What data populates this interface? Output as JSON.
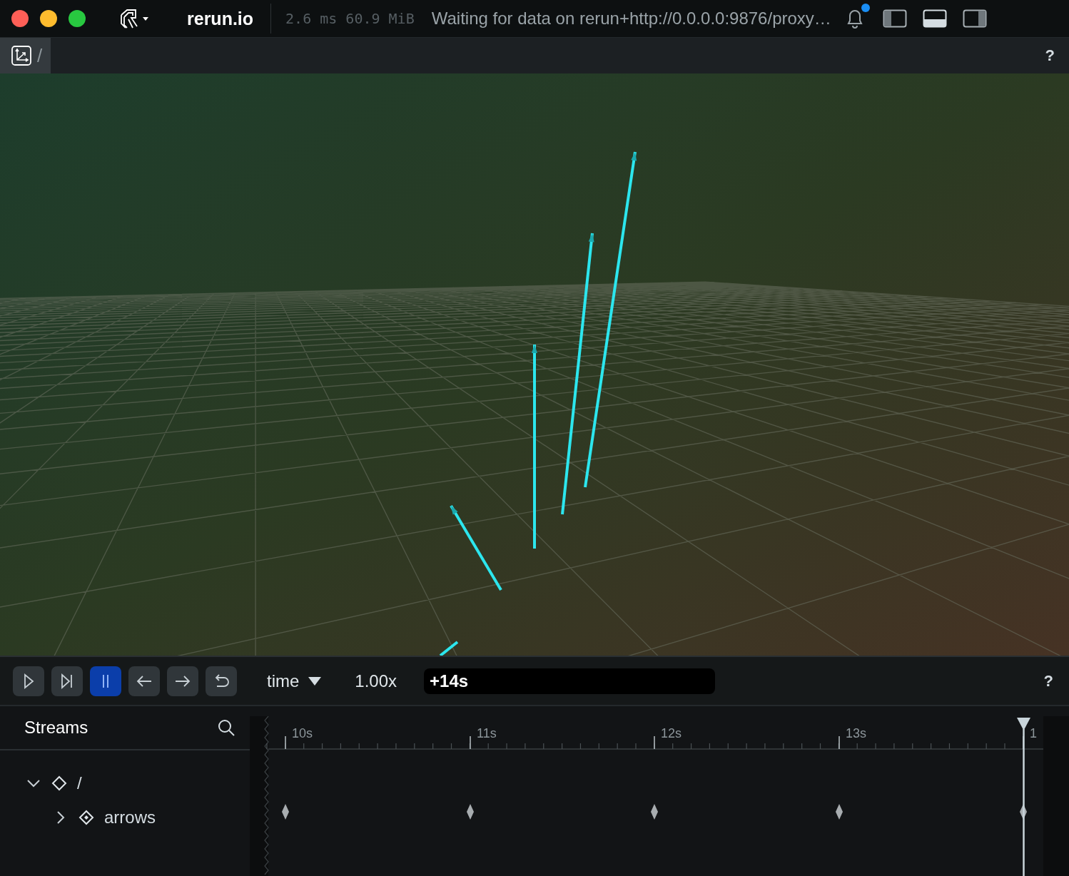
{
  "titlebar": {
    "app_name": "rerun.io",
    "stats": "2.6 ms 60.9 MiB",
    "status": "Waiting for data on rerun+http://0.0.0.0:9876/proxy…",
    "notification_unread": true,
    "panels": [
      {
        "kind": "left",
        "on": false
      },
      {
        "kind": "bottom",
        "on": true
      },
      {
        "kind": "right",
        "on": false
      }
    ]
  },
  "view_tab": {
    "title": "/",
    "help": "?"
  },
  "time_controls": {
    "buttons": [
      {
        "kind": "play",
        "selected": false
      },
      {
        "kind": "step",
        "selected": false
      },
      {
        "kind": "pause",
        "selected": true
      },
      {
        "kind": "prev",
        "selected": false
      },
      {
        "kind": "next",
        "selected": false
      },
      {
        "kind": "loop",
        "selected": false
      }
    ],
    "timeline": "time",
    "speed": "1.00x",
    "current_time": "+14s",
    "help": "?"
  },
  "streams": {
    "title": "Streams",
    "tree": [
      {
        "label": "/",
        "expanded": true,
        "children": [
          {
            "label": "arrows",
            "expanded": false
          }
        ]
      }
    ]
  },
  "timeline": {
    "ticks": [
      "10s",
      "11s",
      "12s",
      "13s",
      "1"
    ]
  }
}
